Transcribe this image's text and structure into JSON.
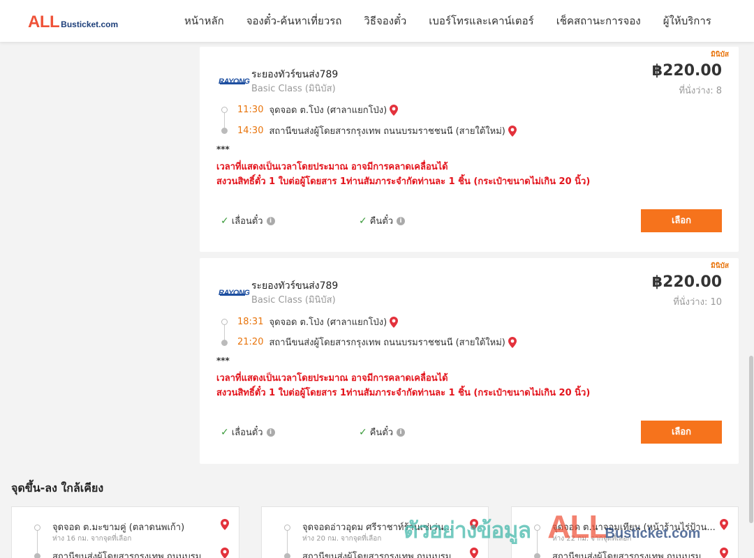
{
  "header": {
    "logo_all": "ALL",
    "logo_rest": "Busticket.com",
    "nav": [
      "หน้าหลัก",
      "จองตั๋ว-ค้นหาเที่ยวรถ",
      "วิธีจองตั๋ว",
      "เบอร์โทรและเคาน์เตอร์",
      "เช็คสถานะการจอง",
      "ผู้ให้บริการ"
    ]
  },
  "trips": [
    {
      "badge": "มินิบัส",
      "operator_logo_text": "RAYONG",
      "operator": "ระยองทัวร์ขนส่ง789",
      "class": "Basic Class (มินิบัส)",
      "price": "฿220.00",
      "seats": "ที่นั่งว่าง: 8",
      "depart_time": "11:30",
      "depart_place": "จุดจอด ต.โป่ง (ศาลาแยกโป่ง)",
      "arrive_time": "14:30",
      "arrive_place": "สถานีขนส่งผู้โดยสารกรุงเทพ ถนนบรมราชชนนี (สายใต้ใหม่)",
      "stars": "***",
      "note1": "เวลาที่แสดงเป็นเวลาโดยประมาณ อาจมีการคลาดเคลื่อนได้",
      "note2": "สงวนสิทธิ์ตั๋ว 1 ใบต่อผู้โดยสาร 1ท่านสัมภาระจำกัดท่านละ 1 ชิ้น (กระเป๋าขนาดไม่เกิน 20 นิ้ว)",
      "feature1": "เลื่อนตั๋ว",
      "feature2": "คืนตั๋ว",
      "select": "เลือก"
    },
    {
      "badge": "มินิบัส",
      "operator_logo_text": "RAYONG",
      "operator": "ระยองทัวร์ขนส่ง789",
      "class": "Basic Class (มินิบัส)",
      "price": "฿220.00",
      "seats": "ที่นั่งว่าง: 10",
      "depart_time": "18:31",
      "depart_place": "จุดจอด ต.โป่ง (ศาลาแยกโป่ง)",
      "arrive_time": "21:20",
      "arrive_place": "สถานีขนส่งผู้โดยสารกรุงเทพ ถนนบรมราชชนนี (สายใต้ใหม่)",
      "stars": "***",
      "note1": "เวลาที่แสดงเป็นเวลาโดยประมาณ อาจมีการคลาดเคลื่อนได้",
      "note2": "สงวนสิทธิ์ตั๋ว 1 ใบต่อผู้โดยสาร 1ท่านสัมภาระจำกัดท่านละ 1 ชิ้น (กระเป๋าขนาดไม่เกิน 20 นิ้ว)",
      "feature1": "เลื่อนตั๋ว",
      "feature2": "คืนตั๋ว",
      "select": "เลือก"
    }
  ],
  "nearby": {
    "title": "จุดขึ้น-ลง ใกล้เคียง",
    "items": [
      {
        "name": "จุดจอด ต.มะขามคู่ (ตลาดนพเก้า)",
        "distance": "ห่าง 16 กม. จากจุดที่เลือก",
        "dest": "สถานีขนส่งผู้โดยสารกรุงเทพ ถนนบรม..."
      },
      {
        "name": "จุดจอดอ่าวอุดม ศรีราชาท์ร้านเซ่เว่น...",
        "distance": "ห่าง 20 กม. จากจุดที่เลือก",
        "dest": "สถานีขนส่งผู้โดยสารกรุงเทพ ถนนบรม..."
      },
      {
        "name": "จุดจอด ต.นาจอมเทียน (หน้าร้านไร่ป้าน...",
        "distance": "ห่าง 22 กม. จากจุดที่เลือก",
        "dest": "สถานีขนส่งผู้โดยสารกรุงเทพ ถนนบรม..."
      }
    ]
  },
  "watermark": {
    "thai": "ตัวอย่างข้อมูล",
    "all": "ALL",
    "rest": "Busticket.com"
  },
  "colors": {
    "accent": "#f6731c",
    "time": "#e8740c",
    "warning": "#e3141c",
    "pin": "#e3323c",
    "check": "#3a9a3a"
  }
}
